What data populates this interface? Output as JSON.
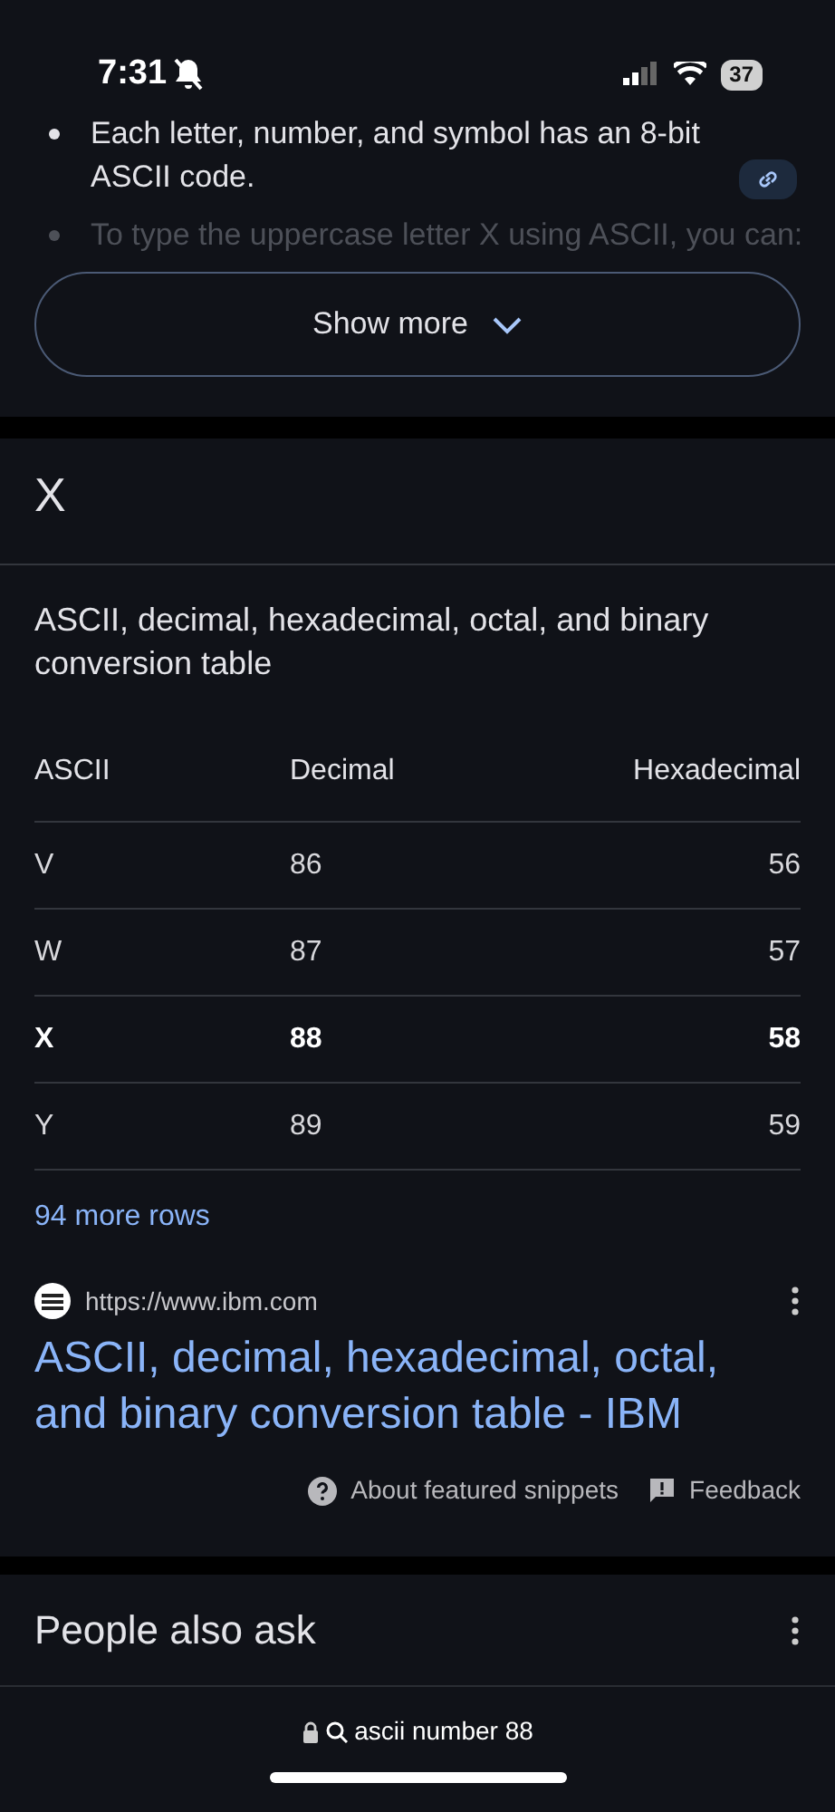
{
  "status_bar": {
    "time": "7:31",
    "battery": "37"
  },
  "snippet": {
    "bullets": [
      {
        "text": "Each letter, number, and symbol has an 8-bit ASCII code.",
        "faded": false,
        "link_chip": true
      },
      {
        "text": "To type the uppercase letter X using ASCII, you can:",
        "faded": true,
        "link_chip": false
      }
    ],
    "show_more": "Show more"
  },
  "answer": "X",
  "table": {
    "caption": "ASCII, decimal, hexadecimal, octal, and binary conversion table",
    "columns": [
      "ASCII",
      "Decimal",
      "Hexadecimal"
    ],
    "rows": [
      {
        "cells": [
          "V",
          "86",
          "56"
        ],
        "highlighted": false
      },
      {
        "cells": [
          "W",
          "87",
          "57"
        ],
        "highlighted": false
      },
      {
        "cells": [
          "X",
          "88",
          "58"
        ],
        "highlighted": true
      },
      {
        "cells": [
          "Y",
          "89",
          "59"
        ],
        "highlighted": false
      }
    ],
    "more_rows": "94 more rows"
  },
  "source": {
    "url": "https://www.ibm.com",
    "title": "ASCII, decimal, hexadecimal, octal, and binary conversion table - IBM"
  },
  "footer_links": [
    "About featured snippets",
    "Feedback"
  ],
  "people_also_ask": {
    "title": "People also ask"
  },
  "address_bar": {
    "query": "ascii number 88"
  }
}
